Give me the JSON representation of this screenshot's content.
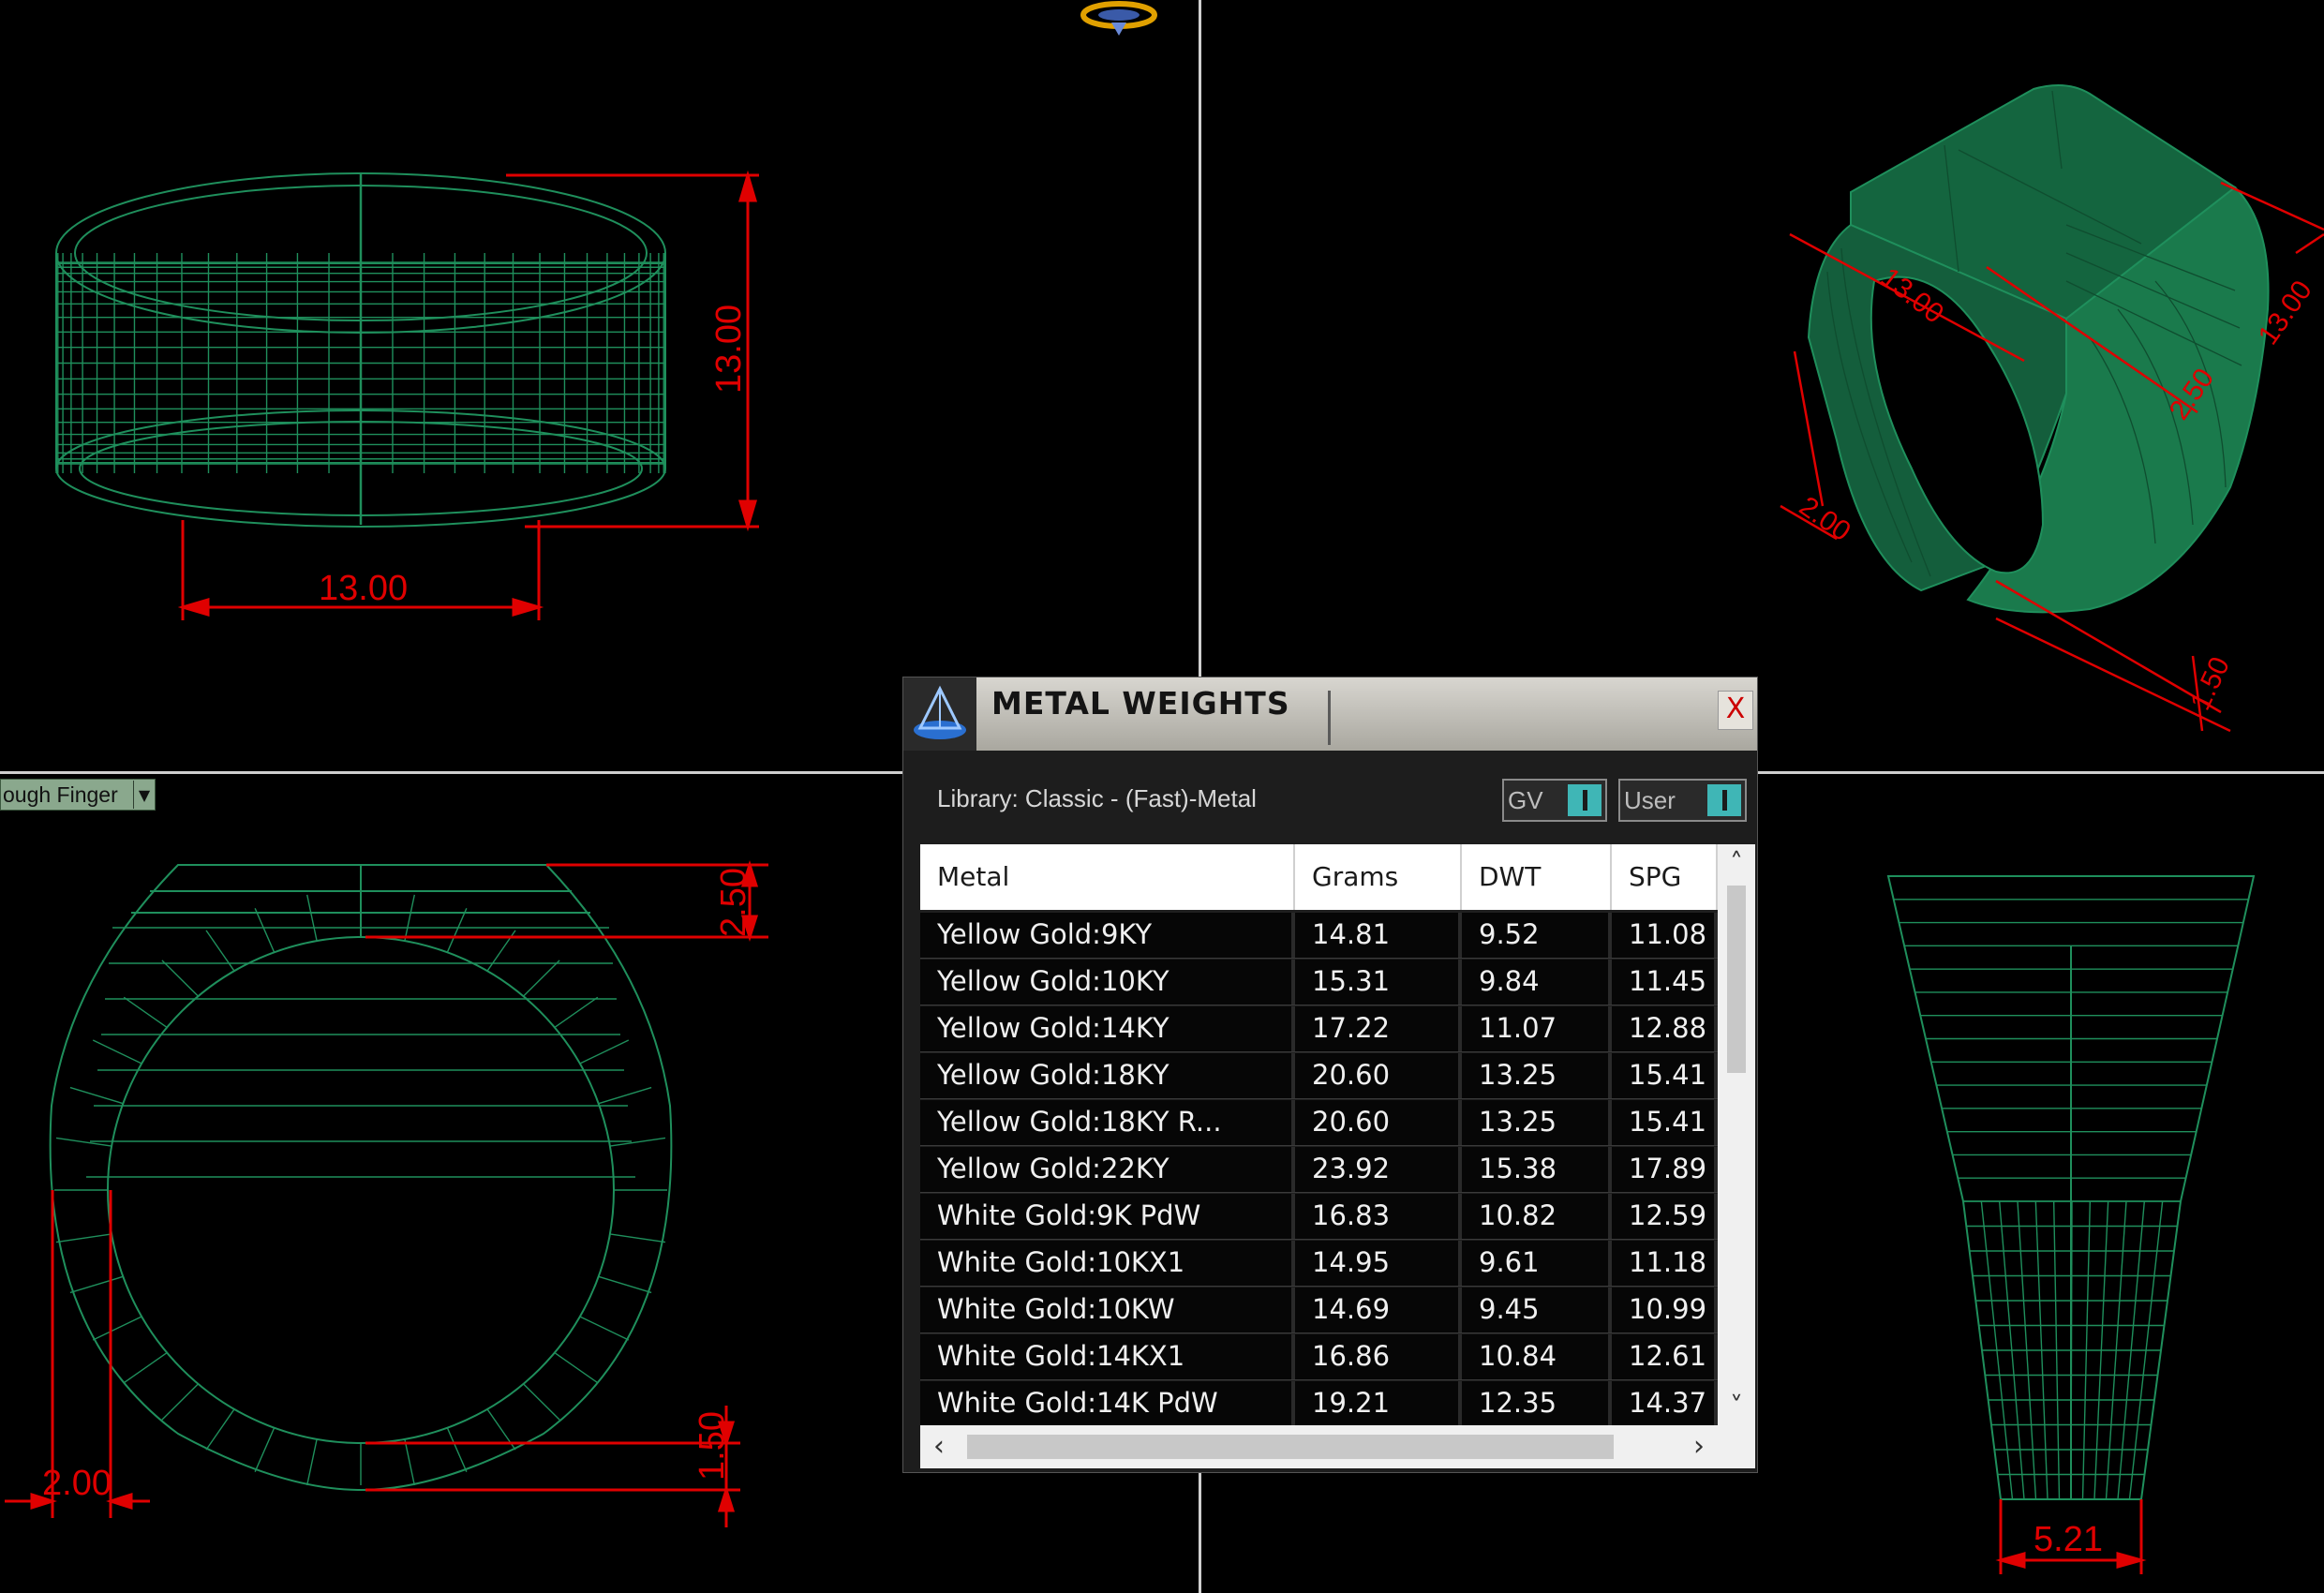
{
  "viewport_dropdown": {
    "label": "ough Finger"
  },
  "dimensions": {
    "front_width": "13.00",
    "front_height": "13.00",
    "perspective_length": "13.00",
    "perspective_depth": "13.00",
    "perspective_small": "2.00",
    "perspective_top": "2.50",
    "perspective_bottom": "1.50",
    "side_top": "2.50",
    "side_left": "2.00",
    "side_bottom": "1.50",
    "profile_width": "5.21"
  },
  "panel": {
    "title": "METAL WEIGHTS",
    "close_label": "X",
    "library_label": "Library: Classic - (Fast)-Metal",
    "toggle_gv": "GV",
    "toggle_user": "User",
    "columns": [
      "Metal",
      "Grams",
      "DWT",
      "SPG"
    ],
    "rows": [
      [
        "Yellow Gold:9KY",
        "14.81",
        "9.52",
        "11.08"
      ],
      [
        "Yellow Gold:10KY",
        "15.31",
        "9.84",
        "11.45"
      ],
      [
        "Yellow Gold:14KY",
        "17.22",
        "11.07",
        "12.88"
      ],
      [
        "Yellow Gold:18KY",
        "20.60",
        "13.25",
        "15.41"
      ],
      [
        "Yellow Gold:18KY R...",
        "20.60",
        "13.25",
        "15.41"
      ],
      [
        "Yellow Gold:22KY",
        "23.92",
        "15.38",
        "17.89"
      ],
      [
        "White Gold:9K PdW",
        "16.83",
        "10.82",
        "12.59"
      ],
      [
        "White Gold:10KX1",
        "14.95",
        "9.61",
        "11.18"
      ],
      [
        "White Gold:10KW",
        "14.69",
        "9.45",
        "10.99"
      ],
      [
        "White Gold:14KX1",
        "16.86",
        "10.84",
        "12.61"
      ],
      [
        "White Gold:14K PdW",
        "19.21",
        "12.35",
        "14.37"
      ]
    ]
  },
  "colors": {
    "wireframe": "#1f8f5c",
    "wireframe_fill": "#14653f",
    "dimension": "#e00000",
    "toggle_accent": "#3fb6b6"
  },
  "icons": {
    "panel_logo": "pyramid-logo-icon",
    "top_center": "ring-gizmo-icon"
  }
}
